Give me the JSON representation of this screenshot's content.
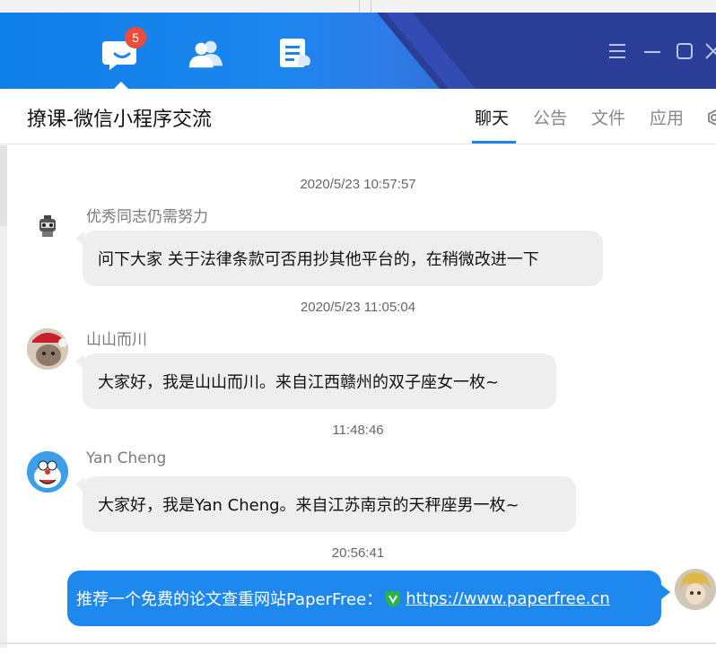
{
  "nav": {
    "badge_count": "5",
    "icons": [
      "chat-icon",
      "contacts-icon",
      "notes-icon"
    ]
  },
  "window_controls": [
    "menu-icon",
    "minimize-icon",
    "maximize-icon",
    "close-icon"
  ],
  "header": {
    "group_title": "撩课-微信小程序交流",
    "tabs": [
      {
        "label": "聊天",
        "active": true
      },
      {
        "label": "公告",
        "active": false
      },
      {
        "label": "文件",
        "active": false
      },
      {
        "label": "应用",
        "active": false
      }
    ]
  },
  "messages": [
    {
      "time": "2020/5/23 10:57:57",
      "sender": "优秀同志仍需努力",
      "text": "问下大家 关于法律条款可否用抄其他平台的，在稍微改进一下"
    },
    {
      "time": "2020/5/23 11:05:04",
      "sender": "山山而川",
      "text": "大家好，我是山山而川。来自江西赣州的双子座女一枚~"
    },
    {
      "time": "11:48:46",
      "sender": "Yan Cheng",
      "text": "大家好，我是Yan Cheng。来自江苏南京的天秤座男一枚~"
    },
    {
      "time": "20:56:41",
      "sender": "",
      "text": "推荐一个免费的论文查重网站PaperFree：",
      "link": "https://www.paperfree.cn"
    }
  ],
  "colors": {
    "accent": "#1c86ee",
    "badge": "#f04a3a",
    "bubble_other": "#eeeeee",
    "bubble_mine": "#1e88ee"
  }
}
